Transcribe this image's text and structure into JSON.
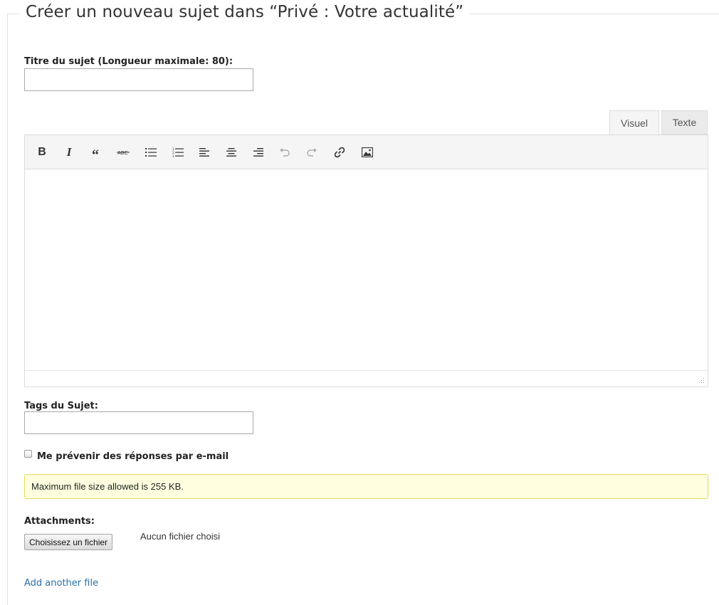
{
  "form": {
    "legend": "Créer un nouveau sujet dans “Privé : Votre actualité”",
    "title_label": "Titre du sujet (Longueur maximale: 80):",
    "title_value": "",
    "tags_label": "Tags du Sujet:",
    "tags_value": "",
    "notify_label": "Me prévenir des réponses par e-mail",
    "notify_checked": false
  },
  "editor": {
    "tabs": [
      {
        "label": "Visuel",
        "active": true
      },
      {
        "label": "Texte",
        "active": false
      }
    ],
    "toolbar": [
      {
        "name": "bold-icon",
        "glyph": "B"
      },
      {
        "name": "italic-icon",
        "glyph": "I"
      },
      {
        "name": "blockquote-icon",
        "glyph": "66"
      },
      {
        "name": "strikethrough-icon",
        "glyph": "ABC"
      },
      {
        "name": "bullet-list-icon"
      },
      {
        "name": "numbered-list-icon"
      },
      {
        "name": "align-left-icon"
      },
      {
        "name": "align-center-icon"
      },
      {
        "name": "align-right-icon"
      },
      {
        "name": "undo-icon"
      },
      {
        "name": "redo-icon"
      },
      {
        "name": "link-icon"
      },
      {
        "name": "image-icon"
      }
    ],
    "content": ""
  },
  "attachments": {
    "notice": "Maximum file size allowed is 255 KB.",
    "label": "Attachments:",
    "choose_button": "Choisissez un fichier",
    "no_file_text": "Aucun fichier choisi",
    "add_another": "Add another file"
  },
  "colors": {
    "notice_bg": "#ffffe0",
    "notice_border": "#e6db55",
    "link": "#2a6fa8"
  }
}
